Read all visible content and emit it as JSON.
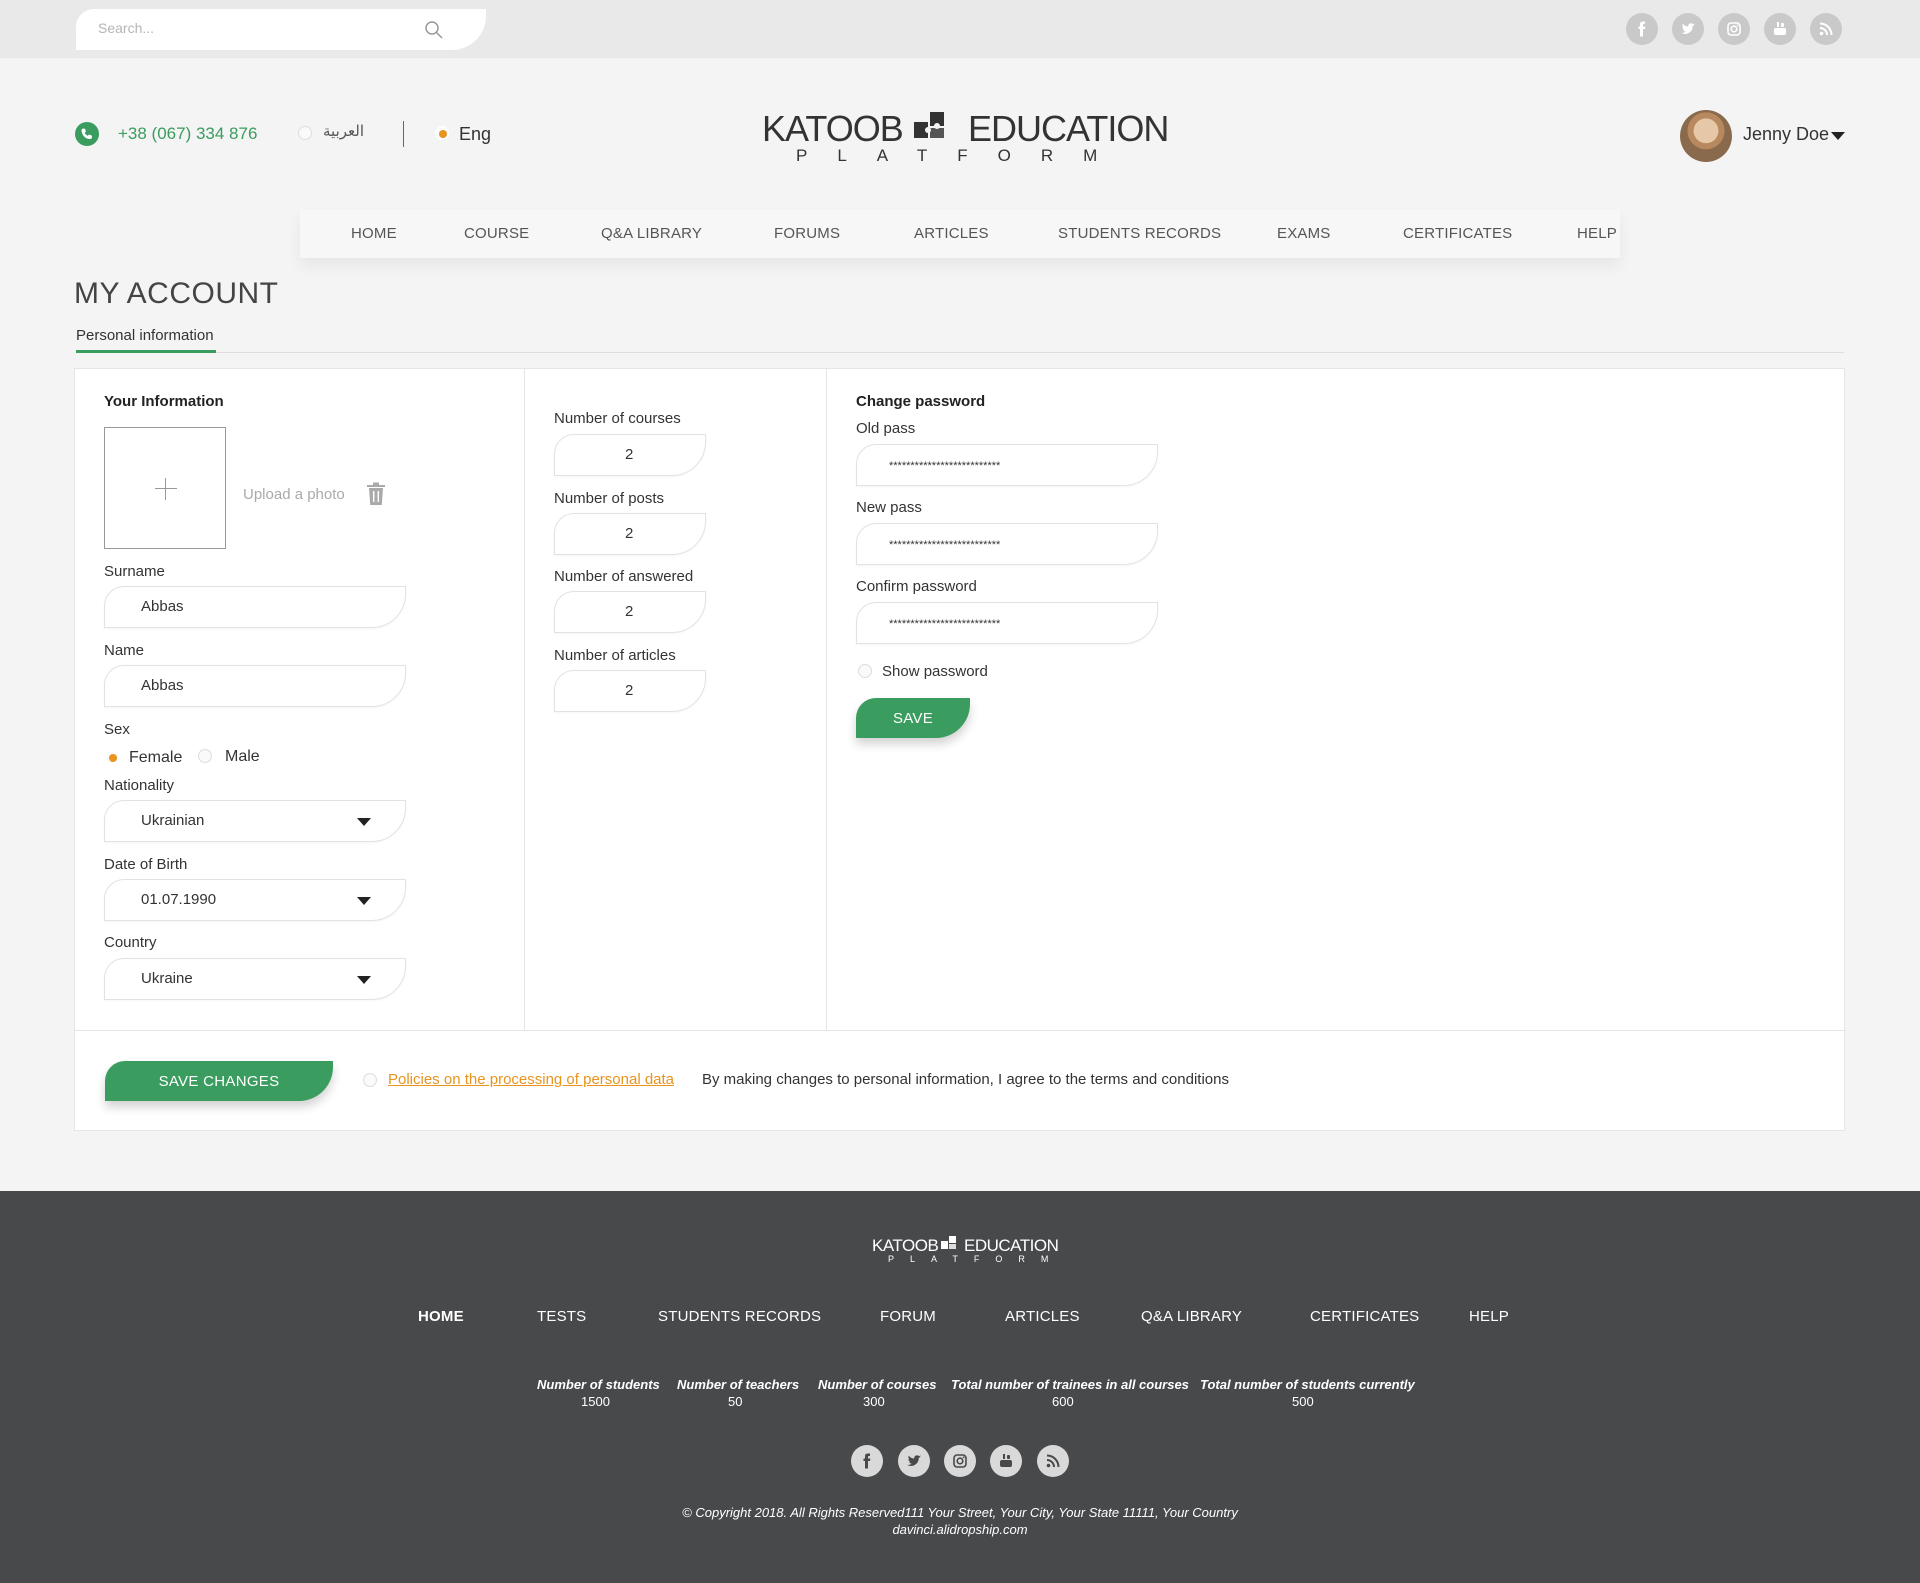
{
  "topbar": {
    "search_placeholder": "Search..."
  },
  "header": {
    "phone": "+38 (067) 334 876",
    "lang_arabic": "العربية",
    "lang_english": "Eng",
    "logo_main_left": "KATOOB",
    "logo_main_right": "EDUCATION",
    "logo_sub": "PLATFORM",
    "user_name": "Jenny Doe"
  },
  "nav": {
    "items": [
      "HOME",
      "COURSE",
      "Q&A LIBRARY",
      "FORUMS",
      "ARTICLES",
      "STUDENTS RECORDS",
      "EXAMS",
      "CERTIFICATES",
      "HELP"
    ]
  },
  "page": {
    "title": "MY ACCOUNT",
    "tab": "Personal information"
  },
  "your_info": {
    "heading": "Your Information",
    "upload_label": "Upload a photo",
    "surname_label": "Surname",
    "surname_value": "Abbas",
    "name_label": "Name",
    "name_value": "Abbas",
    "sex_label": "Sex",
    "sex_female": "Female",
    "sex_male": "Male",
    "nationality_label": "Nationality",
    "nationality_value": "Ukrainian",
    "dob_label": "Date of Birth",
    "dob_value": "01.07.1990",
    "country_label": "Country",
    "country_value": "Ukraine"
  },
  "stats_panel": {
    "courses_label": "Number of courses",
    "courses_value": "2",
    "posts_label": "Number of posts",
    "posts_value": "2",
    "answered_label": "Number of answered",
    "answered_value": "2",
    "articles_label": "Number of articles",
    "articles_value": "2"
  },
  "password": {
    "heading": "Change password",
    "old_label": "Old pass",
    "old_value": "**************************",
    "new_label": "New pass",
    "new_value": "**************************",
    "confirm_label": "Confirm password",
    "confirm_value": "**************************",
    "show_label": "Show password",
    "save_label": "SAVE"
  },
  "bottom": {
    "save_changes_label": "SAVE CHANGES",
    "policy_link": "Policies on the processing of personal data",
    "agree_text": "By making changes to personal information, I agree to the terms and conditions"
  },
  "footer": {
    "logo_main_left": "KATOOB",
    "logo_main_right": "EDUCATION",
    "logo_sub": "PLATFORM",
    "nav": [
      "HOME",
      "TESTS",
      "STUDENTS RECORDS",
      "FORUM",
      "ARTICLES",
      "Q&A LIBRARY",
      "CERTIFICATES",
      "HELP"
    ],
    "stats": [
      {
        "title": "Number of students",
        "value": "1500"
      },
      {
        "title": "Number of teachers",
        "value": "50"
      },
      {
        "title": "Number of courses",
        "value": "300"
      },
      {
        "title": "Total number of trainees in all courses",
        "value": "600"
      },
      {
        "title": "Total number of students currently",
        "value": "500"
      }
    ],
    "copyright": "© Copyright 2018. All Rights Reserved111 Your Street, Your City, Your State 11111, Your Country",
    "site": "davinci.alidropship.com"
  },
  "colors": {
    "accent_green": "#3a9c5e",
    "accent_orange": "#e8941e",
    "footer_bg": "#48494b"
  },
  "icons": [
    "search-icon",
    "facebook-icon",
    "twitter-icon",
    "instagram-icon",
    "youtube-icon",
    "rss-icon",
    "phone-icon",
    "chevron-down-icon",
    "plus-icon",
    "trash-icon"
  ]
}
